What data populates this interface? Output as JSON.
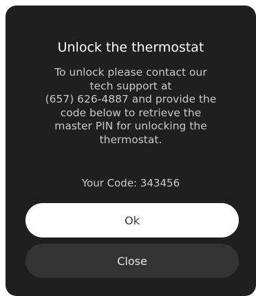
{
  "dialog": {
    "title": "Unlock the thermostat",
    "message_lines": [
      "To unlock please contact our",
      "tech support at",
      "(657) 626-4887 and provide the",
      "code below to retrieve the",
      "master PIN for unlocking the",
      "thermostat."
    ],
    "code_label": "Your Code: 343456",
    "ok_label": "Ok",
    "close_label": "Close"
  },
  "colors": {
    "page_background": "#ffffff",
    "dialog_background": "#1f1f1f",
    "title_text": "#ffffff",
    "body_text": "#c9c9c9",
    "ok_button_background": "#ffffff",
    "ok_button_text": "#3a3a3a",
    "close_button_background": "#333333",
    "close_button_text": "#e6e6e6"
  }
}
